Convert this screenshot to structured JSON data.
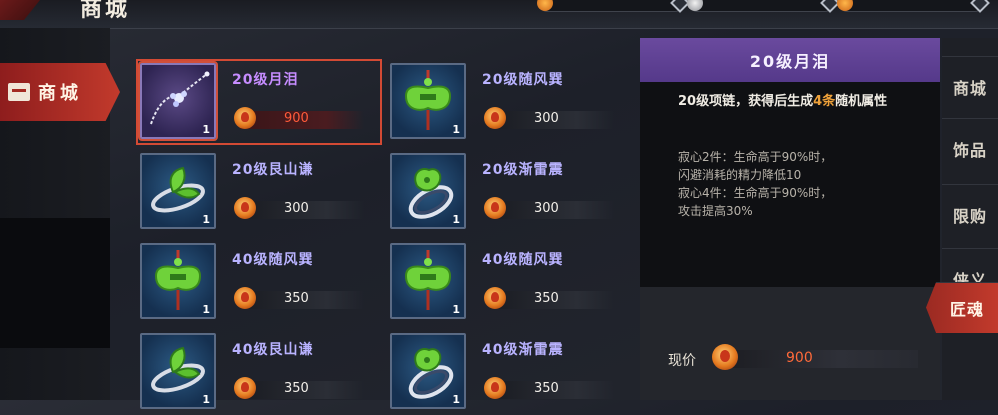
{
  "header": {
    "title": "商城"
  },
  "nav": {
    "active_label": "商城"
  },
  "items": [
    {
      "name": "20级月泪",
      "price": "900",
      "qty": "1",
      "icon": "necklace-icon"
    },
    {
      "name": "20级随风巽",
      "price": "300",
      "qty": "1",
      "icon": "green-pendant-icon"
    },
    {
      "name": "20级艮山谦",
      "price": "300",
      "qty": "1",
      "icon": "leaf-bracelet-icon"
    },
    {
      "name": "20级渐雷震",
      "price": "300",
      "qty": "1",
      "icon": "leaf-ring-icon"
    },
    {
      "name": "40级随风巽",
      "price": "350",
      "qty": "1",
      "icon": "green-pendant-icon"
    },
    {
      "name": "40级随风巽",
      "price": "350",
      "qty": "1",
      "icon": "green-pendant-icon"
    },
    {
      "name": "40级艮山谦",
      "price": "350",
      "qty": "1",
      "icon": "leaf-bracelet-icon"
    },
    {
      "name": "40级渐雷震",
      "price": "350",
      "qty": "1",
      "icon": "leaf-ring-icon"
    }
  ],
  "detail": {
    "title": "20级月泪",
    "desc_a": "20级项链，获得后生成",
    "desc_hl": "4条",
    "desc_b": "随机属性",
    "set_lines": [
      "寂心2件：生命高于90%时，",
      "闪避消耗的精力降低10",
      "寂心4件：生命高于90%时，",
      "攻击提高30%"
    ],
    "price_label": "现价",
    "price_value": "900"
  },
  "tabs": [
    "商城",
    "饰品",
    "限购",
    "侠义",
    "匠魂"
  ],
  "colors": {
    "accent": "#c23a2c",
    "selected_outline": "#d34a34",
    "price_red": "#ff5a3a",
    "header_purple": "#5f4293",
    "highlight": "#f0a23a"
  }
}
